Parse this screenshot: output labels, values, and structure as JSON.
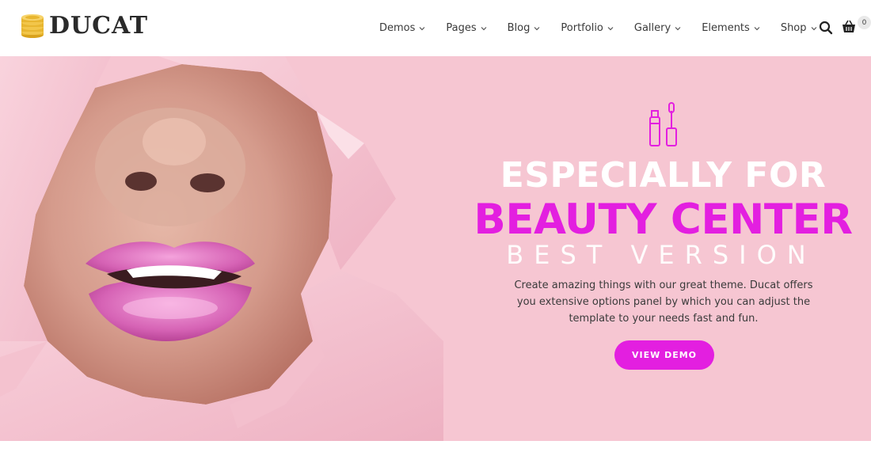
{
  "brand": {
    "name": "DUCAT",
    "logo_icon": "coins-icon"
  },
  "nav": {
    "items": [
      {
        "label": "Demos"
      },
      {
        "label": "Pages"
      },
      {
        "label": "Blog"
      },
      {
        "label": "Portfolio"
      },
      {
        "label": "Gallery"
      },
      {
        "label": "Elements"
      },
      {
        "label": "Shop"
      }
    ],
    "search_icon": "search-icon",
    "cart_icon": "cart-icon",
    "cart_count": "0"
  },
  "hero": {
    "icon": "lipgloss-mascara-icon",
    "line1": "ESPECIALLY FOR",
    "line2": "BEAUTY CENTER",
    "line3": "BEST VERSION",
    "description": "Create amazing things with our great theme. Ducat offers you extensive options panel by which you can adjust the template to your needs fast and fun.",
    "cta_label": "VIEW DEMO"
  },
  "colors": {
    "accent": "#e31fe0",
    "hero_background": "#f6c6d2",
    "text_dark": "#333333"
  }
}
